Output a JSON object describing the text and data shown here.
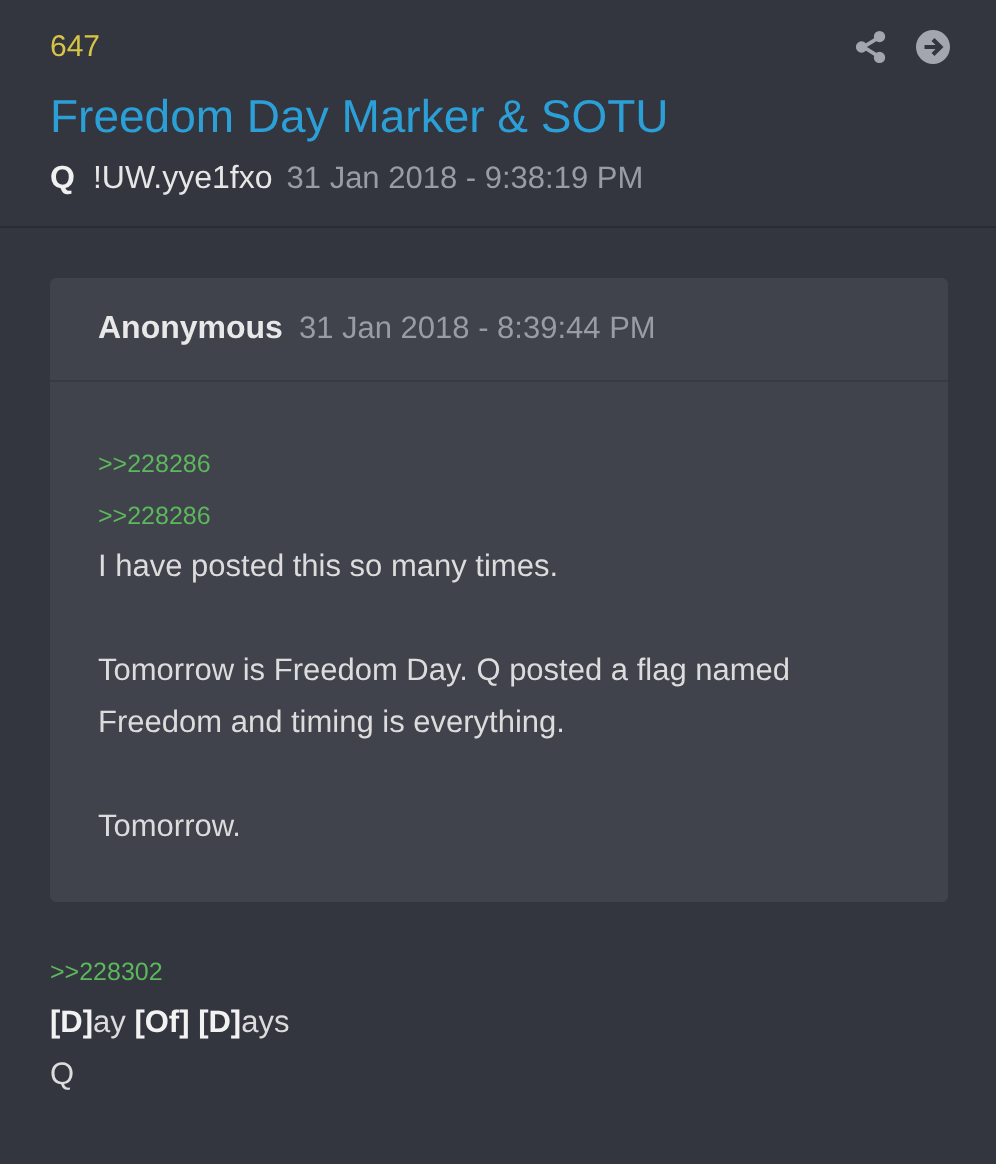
{
  "post": {
    "number": "647",
    "title": "Freedom Day Marker & SOTU",
    "author": "Q",
    "tripcode": "!UW.yye1fxo",
    "timestamp": "31 Jan 2018 - 9:38:19 PM"
  },
  "quote": {
    "author": "Anonymous",
    "timestamp": "31 Jan 2018 - 8:39:44 PM",
    "body": [
      {
        "kind": "ref",
        "text": ">>228286"
      },
      {
        "kind": "ref",
        "text": ">>228286"
      },
      {
        "kind": "text",
        "text": "I have posted this so many times."
      },
      {
        "kind": "gap"
      },
      {
        "kind": "text",
        "text": "Tomorrow is Freedom Day. Q posted a flag named Freedom and timing is everything."
      },
      {
        "kind": "gap"
      },
      {
        "kind": "text",
        "text": "Tomorrow."
      }
    ]
  },
  "body": [
    {
      "kind": "ref",
      "text": ">>228302"
    },
    {
      "kind": "text",
      "text": "**[D]**ay **[Of]** **[D]**ays"
    },
    {
      "kind": "text",
      "text": "Q"
    }
  ]
}
